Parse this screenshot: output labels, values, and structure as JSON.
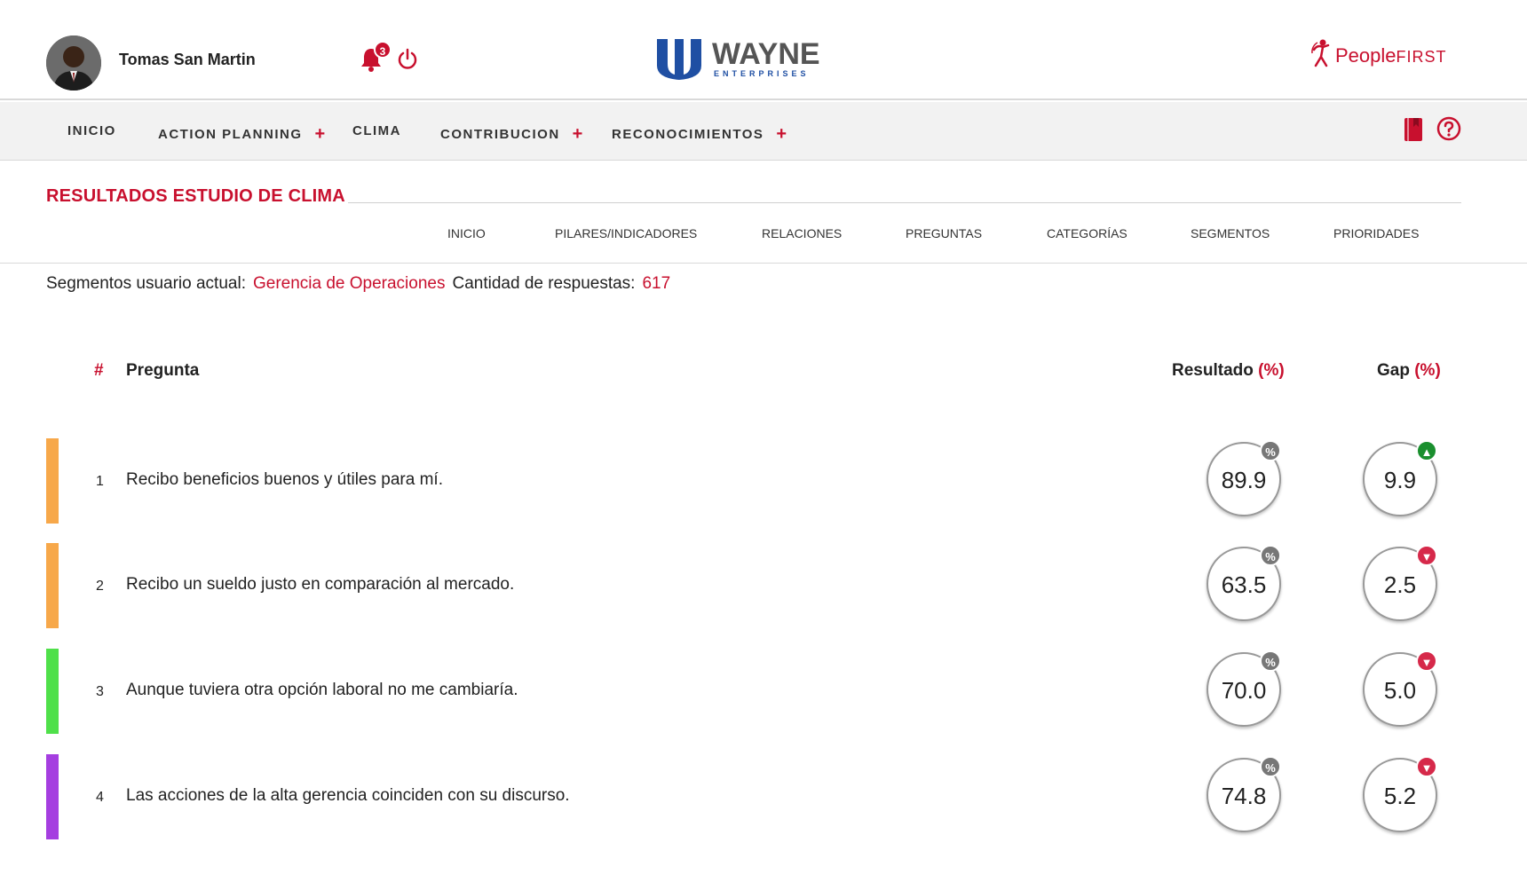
{
  "header": {
    "user_name": "Tomas San Martin",
    "notifications_count": "3",
    "brand_left": {
      "main": "WAYNE",
      "sub": "ENTERPRISES"
    },
    "brand_right": {
      "people": "People",
      "first": "FIRST"
    },
    "colors": {
      "accent": "#c8102e",
      "wayne_blue": "#1f4fa3"
    }
  },
  "nav": {
    "items": [
      {
        "label": "INICIO",
        "has_plus": false
      },
      {
        "label": "ACTION PLANNING",
        "has_plus": true
      },
      {
        "label": "CLIMA",
        "has_plus": false
      },
      {
        "label": "CONTRIBUCION",
        "has_plus": true
      },
      {
        "label": "RECONOCIMIENTOS",
        "has_plus": true
      }
    ],
    "plus_symbol": "+",
    "icons": [
      "book-icon",
      "help-icon"
    ]
  },
  "section": {
    "title": "RESULTADOS ESTUDIO DE CLIMA",
    "subnav": [
      "INICIO",
      "PILARES/INDICADORES",
      "RELACIONES",
      "PREGUNTAS",
      "CATEGORÍAS",
      "SEGMENTOS",
      "PRIORIDADES"
    ]
  },
  "segment": {
    "label": "Segmentos usuario actual:",
    "value": "Gerencia de Operaciones",
    "count_label": "Cantidad de respuestas:",
    "count_value": "617"
  },
  "table": {
    "headers": {
      "hash": "#",
      "question": "Pregunta",
      "result": "Resultado",
      "result_unit": "(%)",
      "gap": "Gap",
      "gap_unit": "(%)"
    },
    "rows": [
      {
        "num": "1",
        "text": "Recibo beneficios buenos y útiles para mí.",
        "result": "89.9",
        "gap": "9.9",
        "gap_dir": "up",
        "bar_color": "#f7a84a"
      },
      {
        "num": "2",
        "text": "Recibo un sueldo justo en comparación al mercado.",
        "result": "63.5",
        "gap": "2.5",
        "gap_dir": "down",
        "bar_color": "#f7a84a"
      },
      {
        "num": "3",
        "text": "Aunque tuviera otra opción laboral no me cambiaría.",
        "result": "70.0",
        "gap": "5.0",
        "gap_dir": "down",
        "bar_color": "#4fe04a"
      },
      {
        "num": "4",
        "text": "Las acciones de la alta gerencia coinciden con su discurso.",
        "result": "74.8",
        "gap": "5.2",
        "gap_dir": "down",
        "bar_color": "#a53ee0"
      }
    ],
    "pct_symbol": "%",
    "up_symbol": "▲",
    "down_symbol": "▼"
  }
}
